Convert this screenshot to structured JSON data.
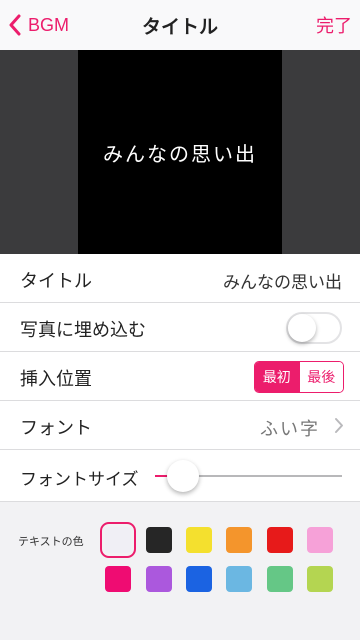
{
  "navbar": {
    "back_label": "BGM",
    "title": "タイトル",
    "done_label": "完了",
    "accent": "#ec1d6c"
  },
  "preview": {
    "text": "みんなの思い出"
  },
  "settings": {
    "title_row": {
      "label": "タイトル",
      "value": "みんなの思い出"
    },
    "embed_row": {
      "label": "写真に埋め込む",
      "toggle_on": false
    },
    "position_row": {
      "label": "挿入位置",
      "options": [
        "最初",
        "最後"
      ],
      "selected": "最初"
    },
    "font_row": {
      "label": "フォント",
      "value": "ふい字"
    },
    "font_size_row": {
      "label": "フォントサイズ",
      "slider_fraction": 0.15
    }
  },
  "text_color": {
    "label": "テキストの色",
    "swatches": [
      "#f0eff5",
      "#262626",
      "#f4e02e",
      "#f4952c",
      "#e71a1a",
      "#f6a1d8",
      "#ef0c72",
      "#ab58dd",
      "#1b63e2",
      "#6bb7e2",
      "#65c786",
      "#b4d551"
    ],
    "selected_index": 0
  }
}
